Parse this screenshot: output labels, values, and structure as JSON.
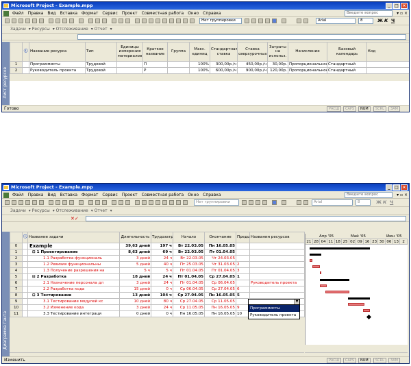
{
  "win1": {
    "title": "Microsoft Project - Example.mpp",
    "menu": [
      "Файл",
      "Правка",
      "Вид",
      "Вставка",
      "Формат",
      "Сервис",
      "Проект",
      "Совместная работа",
      "Окно",
      "Справка"
    ],
    "ask": "Введите вопрос",
    "grouping": "Нет группировки",
    "font": "Arial",
    "size": "8",
    "fmt": [
      "Ж",
      "К",
      "Ч"
    ],
    "toolbar2": [
      "Задачи",
      "Ресурсы",
      "Отслеживание",
      "Отчет"
    ],
    "viewbar": "Лист ресурсов",
    "headers": [
      "Название ресурса",
      "Тип",
      "Единицы измерения материалов",
      "Краткое название",
      "Группа",
      "Макс. единиц",
      "Стандартная ставка",
      "Ставка сверхурочных",
      "Затраты на использ.",
      "Начисление",
      "Базовый календарь",
      "Код"
    ],
    "rows": [
      {
        "n": "1",
        "name": "Программисты",
        "type": "Трудовой",
        "unit": "",
        "short": "П",
        "group": "",
        "max": "100%",
        "std": "300,00р./ч",
        "ovt": "450,00р./ч",
        "cost": "30,00р.",
        "accr": "Пропорциональное",
        "cal": "Стандартный",
        "code": ""
      },
      {
        "n": "2",
        "name": "Руководитель проекта",
        "type": "Трудовой",
        "unit": "",
        "short": "Р",
        "group": "",
        "max": "100%",
        "std": "600,00р./ч",
        "ovt": "900,00р./ч",
        "cost": "120,00р.",
        "accr": "Пропорциональное",
        "cal": "Стандартный",
        "code": ""
      }
    ],
    "status": "Готово",
    "indicators": [
      "РАСШ",
      "CAPS",
      "NUM",
      "SCRL",
      "ЗАМ"
    ]
  },
  "win2": {
    "title": "Microsoft Project - Example.mpp",
    "menu": [
      "Файл",
      "Правка",
      "Вид",
      "Вставка",
      "Формат",
      "Сервис",
      "Проект",
      "Совместная работа",
      "Окно",
      "Справка"
    ],
    "ask": "Введите вопрос",
    "grouping": "Нет группировки",
    "font": "Arial",
    "size": "8",
    "fmt": [
      "Ж",
      "К",
      "Ч"
    ],
    "toolbar2": [
      "Задачи",
      "Ресурсы",
      "Отслеживание",
      "Отчет"
    ],
    "editmarks": "✕✓",
    "viewbar": "Диаграмма Ганта",
    "headers": [
      "Название задачи",
      "Длительность",
      "Трудозатраты",
      "Начало",
      "Окончание",
      "Предш",
      "Названия ресурсов"
    ],
    "rows": [
      {
        "n": "0",
        "name": "Example",
        "dur": "39,63 дней",
        "work": "197 ч",
        "start": "Вт 22.03.05",
        "end": "Пн 16.05.05",
        "pred": "",
        "res": "",
        "style": "top"
      },
      {
        "n": "1",
        "name": "⊟ 1 Проектирование",
        "dur": "8,63 дней",
        "work": "69 ч",
        "start": "Вт 22.03.05",
        "end": "Пт 01.04.05",
        "pred": "",
        "res": "",
        "style": "sum"
      },
      {
        "n": "2",
        "name": "1.1 Разработка функциональ",
        "dur": "3 дней",
        "work": "24 ч",
        "start": "Вт 22.03.05",
        "end": "Чт 24.03.05",
        "pred": "",
        "res": "",
        "style": "crit"
      },
      {
        "n": "3",
        "name": "1.2 Ревизия функциональны",
        "dur": "5 дней",
        "work": "40 ч",
        "start": "Пт 25.03.05",
        "end": "Чт 31.03.05",
        "pred": "2",
        "res": "",
        "style": "crit"
      },
      {
        "n": "4",
        "name": "1.3 Получение разрешения на",
        "dur": "5 ч",
        "work": "5 ч",
        "start": "Пт 01.04.05",
        "end": "Пт 01.04.05",
        "pred": "3",
        "res": "",
        "style": "crit"
      },
      {
        "n": "5",
        "name": "⊟ 2 Разработка",
        "dur": "18 дней",
        "work": "24 ч",
        "start": "Пт 01.04.05",
        "end": "Ср 27.04.05",
        "pred": "1",
        "res": "",
        "style": "sum"
      },
      {
        "n": "6",
        "name": "2.1 Назначение персонала дл",
        "dur": "3 дней",
        "work": "24 ч",
        "start": "Пт 01.04.05",
        "end": "Ср 06.04.05",
        "pred": "",
        "res": "Руководитель проекта",
        "style": "crit"
      },
      {
        "n": "7",
        "name": "2.2 Разработка кода",
        "dur": "15 дней",
        "work": "0 ч",
        "start": "Ср 06.04.05",
        "end": "Ср 27.04.05",
        "pred": "6",
        "res": "",
        "style": "crit"
      },
      {
        "n": "8",
        "name": "⊟ 3 Тестирование",
        "dur": "13 дней",
        "work": "104 ч",
        "start": "Ср 27.04.05",
        "end": "Пн 16.05.05",
        "pred": "5",
        "res": "",
        "style": "sum"
      },
      {
        "n": "9",
        "name": "3.1 Тестирование модулей кс",
        "dur": "10 дней",
        "work": "80 ч",
        "start": "Ср 27.04.05",
        "end": "Ср 11.05.05",
        "pred": "",
        "res": "",
        "style": "crit"
      },
      {
        "n": "10",
        "name": "3.2 Изменение кода",
        "dur": "3 дней",
        "work": "24 ч",
        "start": "Ср 11.05.05",
        "end": "Пн 16.05.05",
        "pred": "9",
        "res": "",
        "style": "crit"
      },
      {
        "n": "11",
        "name": "3.3 Тестирование интеграци",
        "dur": "0 дней",
        "work": "0 ч",
        "start": "Пн 16.05.05",
        "end": "Пн 16.05.05",
        "pred": "10",
        "res": "",
        "style": "norm"
      }
    ],
    "dropdown": [
      "Программисты",
      "Руководитель проекта"
    ],
    "gantt": {
      "months": [
        "Апр '05",
        "Май '05",
        "Июн '05"
      ],
      "days": [
        "21",
        "28",
        "04",
        "11",
        "18",
        "25",
        "02",
        "09",
        "16",
        "23",
        "30",
        "06",
        "13",
        "2"
      ]
    },
    "status": "Изменить",
    "indicators": [
      "РАСШ",
      "CAPS",
      "NUM",
      "SCRL",
      "ЗАМ"
    ]
  }
}
